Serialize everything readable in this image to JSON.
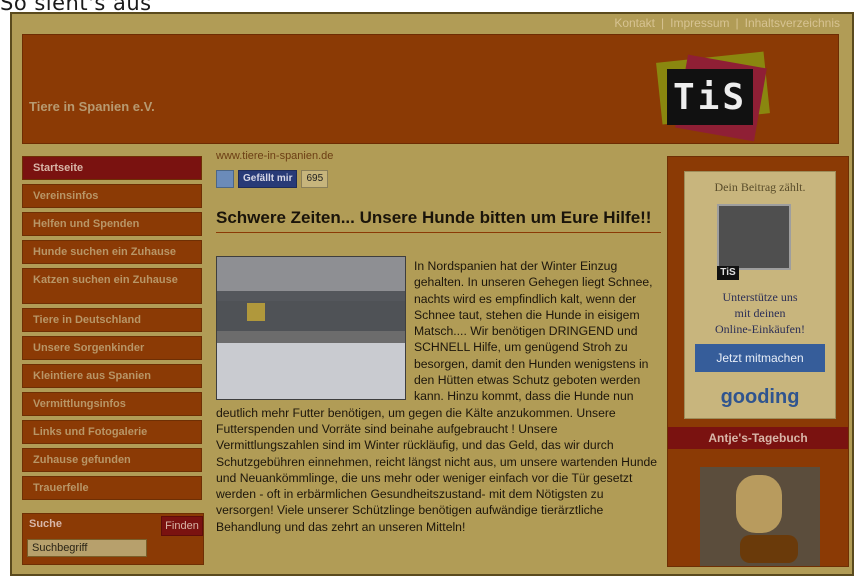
{
  "top_label": "So sieht's aus",
  "topbar": {
    "links": [
      "Kontakt",
      "Impressum",
      "Inhaltsverzeichnis"
    ],
    "separator": "|"
  },
  "header": {
    "site_title": "Tiere in Spanien e.V.",
    "logo_text": "TiS"
  },
  "sidebar": {
    "items": [
      "Startseite",
      "Vereinsinfos",
      "Helfen und Spenden",
      "Hunde suchen ein Zuhause",
      "Katzen suchen ein Zuhause",
      "Tiere in Deutschland",
      "Unsere Sorgenkinder",
      "Kleintiere aus Spanien",
      "Vermittlungsinfos",
      "Links und Fotogalerie",
      "Zuhause gefunden",
      "Trauerfelle"
    ],
    "active_index": 0
  },
  "search": {
    "title": "Suche",
    "button": "Finden",
    "placeholder": "Suchbegriff"
  },
  "social": {
    "url": "www.tiere-in-spanien.de",
    "like_label": "Gefällt mir",
    "like_count": "695"
  },
  "post": {
    "title": "Schwere Zeiten... Unsere Hunde bitten um Eure Hilfe!!",
    "body": "In Nordspanien hat der Winter Einzug gehalten. In unseren Gehegen liegt Schnee, nachts wird es empfindlich kalt, wenn der Schnee taut, stehen die Hunde in eisigem Matsch.... Wir benötigen DRINGEND und SCHNELL Hilfe, um genügend Stroh zu besorgen, damit den Hunden wenigstens in den Hütten etwas Schutz geboten werden kann. Hinzu kommt, dass die Hunde nun deutlich mehr Futter benötigen, um gegen die Kälte anzukommen. Unsere Futterspenden und Vorräte sind beinahe aufgebraucht ! Unsere Vermittlungszahlen sind im Winter rückläufig, und das Geld, das wir durch Schutzgebühren einnehmen, reicht längst nicht aus, um unsere wartenden Hunde und Neuankömmlinge, die uns mehr oder weniger einfach vor die Tür gesetzt werden - oft in erbärmlichen Gesundheitszustand- mit dem Nötigsten zu versorgen! Viele unserer Schützlinge benötigen aufwändige tierärztliche Behandlung und das zehrt an unseren Mitteln!"
  },
  "ad": {
    "top": "Dein Beitrag zählt.",
    "badge": "TiS",
    "line1": "Unterstütze uns",
    "line2": "mit deinen",
    "line3": "Online-Einkäufen!",
    "button": "Jetzt mitmachen",
    "brand": "gooding"
  },
  "diary": {
    "title": "Antje's-Tagebuch"
  }
}
